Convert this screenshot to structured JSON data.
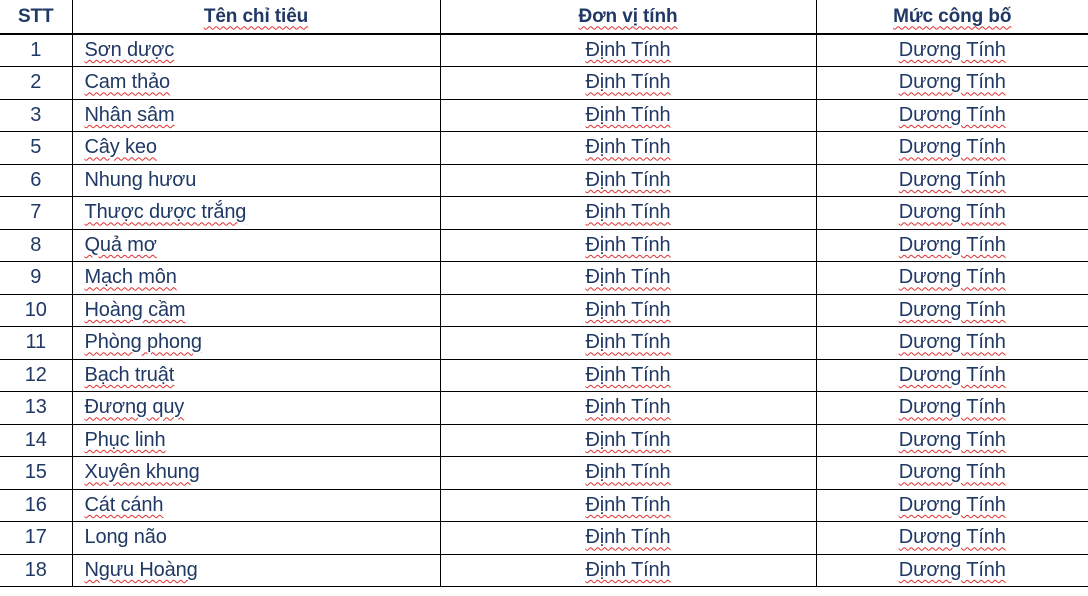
{
  "table": {
    "columns": [
      {
        "key": "stt",
        "label": "STT",
        "squiggly": false
      },
      {
        "key": "name",
        "label": "Tên chỉ tiêu",
        "squiggly": true
      },
      {
        "key": "unit",
        "label": "Đơn vị tính",
        "squiggly": true
      },
      {
        "key": "level",
        "label": "Mức công bố",
        "squiggly": true
      }
    ],
    "rows": [
      {
        "stt": "1",
        "name": "Sơn dược",
        "name_squiggly": true,
        "unit": "Định Tính",
        "level": "Dương Tính"
      },
      {
        "stt": "2",
        "name": "Cam thảo",
        "name_squiggly": true,
        "unit": "Định Tính",
        "level": "Dương Tính"
      },
      {
        "stt": "3",
        "name": "Nhân sâm",
        "name_squiggly": true,
        "unit": "Định Tính",
        "level": "Dương Tính"
      },
      {
        "stt": "5",
        "name": "Cây keo",
        "name_squiggly": true,
        "unit": "Định Tính",
        "level": "Dương Tính"
      },
      {
        "stt": "6",
        "name": "Nhung hươu",
        "name_squiggly": false,
        "unit": "Định Tính",
        "level": "Dương Tính"
      },
      {
        "stt": "7",
        "name": "Thược dược trắng",
        "name_squiggly": true,
        "unit": "Định Tính",
        "level": "Dương Tính"
      },
      {
        "stt": "8",
        "name": "Quả mơ",
        "name_squiggly": true,
        "unit": "Định Tính",
        "level": "Dương Tính"
      },
      {
        "stt": "9",
        "name": "Mạch môn",
        "name_squiggly": true,
        "unit": "Định Tính",
        "level": "Dương Tính"
      },
      {
        "stt": "10",
        "name": "Hoàng cầm",
        "name_squiggly": true,
        "unit": "Định Tính",
        "level": "Dương Tính"
      },
      {
        "stt": "11",
        "name": "Phòng phong",
        "name_squiggly": true,
        "unit": "Định Tính",
        "level": "Dương Tính"
      },
      {
        "stt": "12",
        "name": "Bạch truật",
        "name_squiggly": true,
        "unit": "Định Tính",
        "level": "Dương Tính"
      },
      {
        "stt": "13",
        "name": "Đương quy",
        "name_squiggly": true,
        "unit": "Định Tính",
        "level": "Dương Tính"
      },
      {
        "stt": "14",
        "name": "Phục linh",
        "name_squiggly": true,
        "unit": "Định Tính",
        "level": "Dương Tính"
      },
      {
        "stt": "15",
        "name": "Xuyên khung",
        "name_squiggly": true,
        "unit": "Định Tính",
        "level": "Dương Tính"
      },
      {
        "stt": "16",
        "name": "Cát cánh",
        "name_squiggly": true,
        "unit": "Định Tính",
        "level": "Dương Tính"
      },
      {
        "stt": "17",
        "name": "Long não",
        "name_squiggly": false,
        "unit": "Định Tính",
        "level": "Dương Tính"
      },
      {
        "stt": "18",
        "name": "Ngưu Hoàng",
        "name_squiggly": true,
        "unit": "Định Tính",
        "level": "Dương Tính"
      }
    ]
  },
  "colors": {
    "text": "#1F3864",
    "grid": "#000000",
    "background": "#FFFFFF",
    "spellcheck_underline": "#E03030"
  }
}
